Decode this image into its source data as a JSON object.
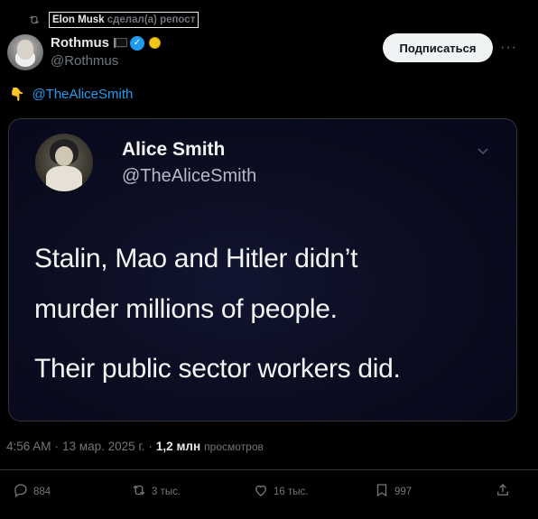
{
  "repost": {
    "icon": "repost-icon",
    "who": "Elon Musk",
    "text": "сделал(а) репост"
  },
  "author": {
    "name": "Rothmus",
    "handle": "@Rothmus",
    "icons": [
      "flag-icon",
      "verified-badge-icon",
      "gold-badge-icon"
    ]
  },
  "follow_label": "Подписаться",
  "more_label": "···",
  "tweet": {
    "emoji": "👇",
    "mention": "@TheAliceSmith"
  },
  "media": {
    "name": "Alice Smith",
    "handle": "@TheAliceSmith",
    "line1": "Stalin, Mao and Hitler didn’t",
    "line2": "murder millions of people.",
    "line3": "Their public sector workers did."
  },
  "meta": {
    "time": "4:56 AM",
    "date": "13 мар. 2025 г.",
    "sep": "·",
    "views_count": "1,2 млн",
    "views_label": "просмотров"
  },
  "actions": {
    "replies": "884",
    "reposts": "3 тыс.",
    "likes": "16 тыс.",
    "bookmarks": "997"
  },
  "colors": {
    "background": "#000000",
    "accent": "#1d9bf0",
    "muted": "#71767b",
    "text": "#e7e9ea"
  }
}
